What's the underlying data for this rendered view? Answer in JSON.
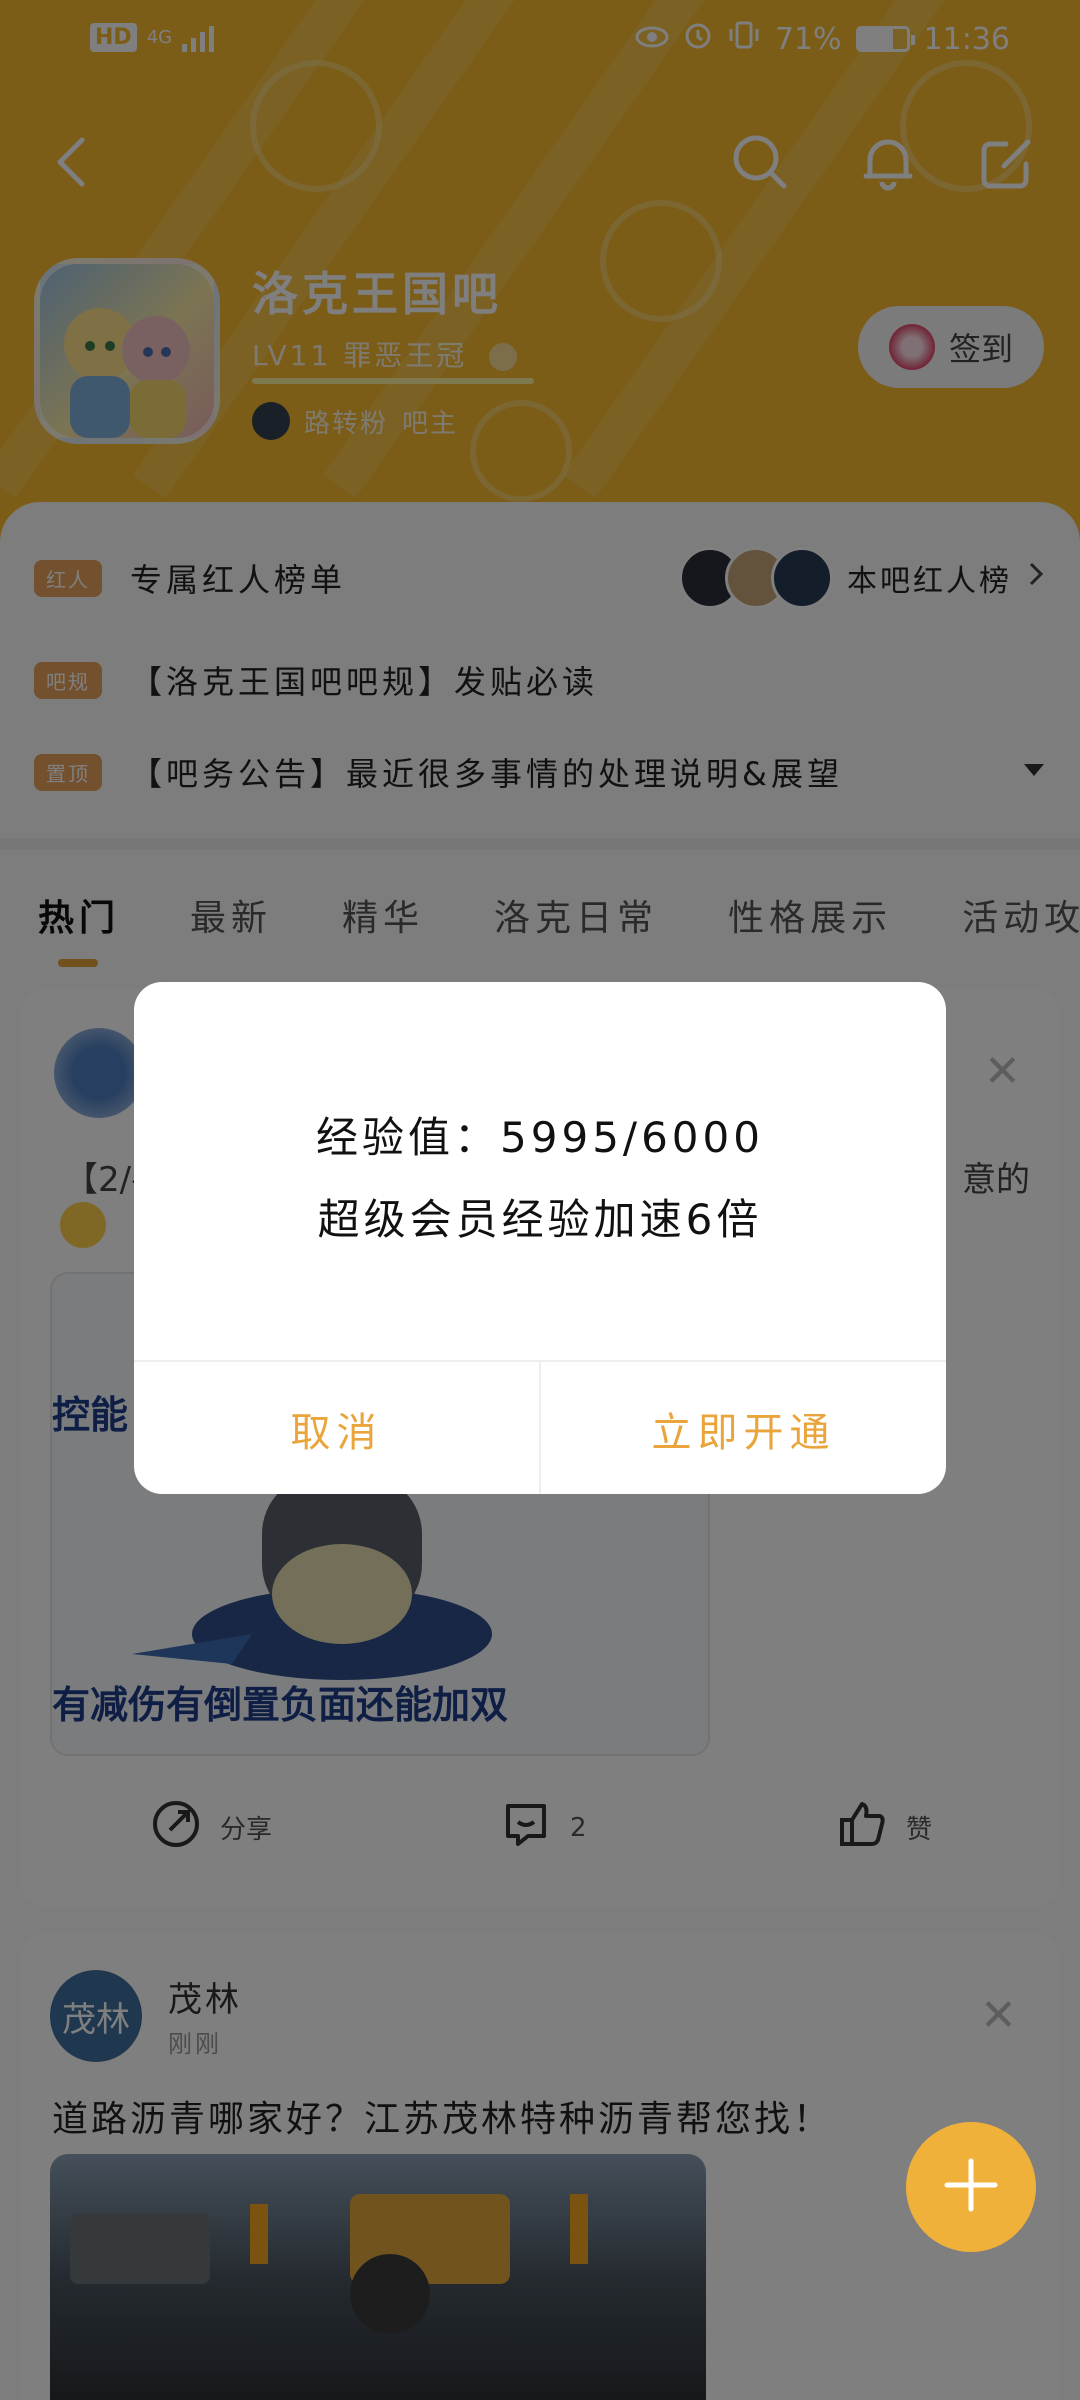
{
  "status": {
    "network": "4G",
    "battery": "71%",
    "time": "11:36"
  },
  "forum": {
    "name": "洛克王国吧",
    "level": "LV11 罪恶王冠",
    "level_progress": 0.999,
    "owner_name": "路转粉",
    "owner_role": "吧主",
    "signin_label": "签到"
  },
  "notices": [
    {
      "tag": "红人",
      "text": "专属红人榜单",
      "right": "本吧红人榜"
    },
    {
      "tag": "吧规",
      "text": "【洛克王国吧吧规】发贴必读"
    },
    {
      "tag": "置顶",
      "text": "【吧务公告】最近很多事情的处理说明&展望"
    }
  ],
  "tabs": [
    "热门",
    "最新",
    "精华",
    "洛克日常",
    "性格展示",
    "活动攻"
  ],
  "post1": {
    "snippet_left": "【2/-",
    "snippet_right": "意的",
    "img_text_top": "控能",
    "img_text_bottom": "有减伤有倒置负面还能加双",
    "share_label": "分享",
    "comment_count": "2",
    "like_label": "赞"
  },
  "post2": {
    "author": "茂林",
    "time": "刚刚",
    "avatar_text": "茂林",
    "title": "道路沥青哪家好？江苏茂林特种沥青帮您找！"
  },
  "dialog": {
    "line1": "经验值：5995/6000",
    "line2": "超级会员经验加速6倍",
    "cancel": "取消",
    "confirm": "立即开通"
  }
}
